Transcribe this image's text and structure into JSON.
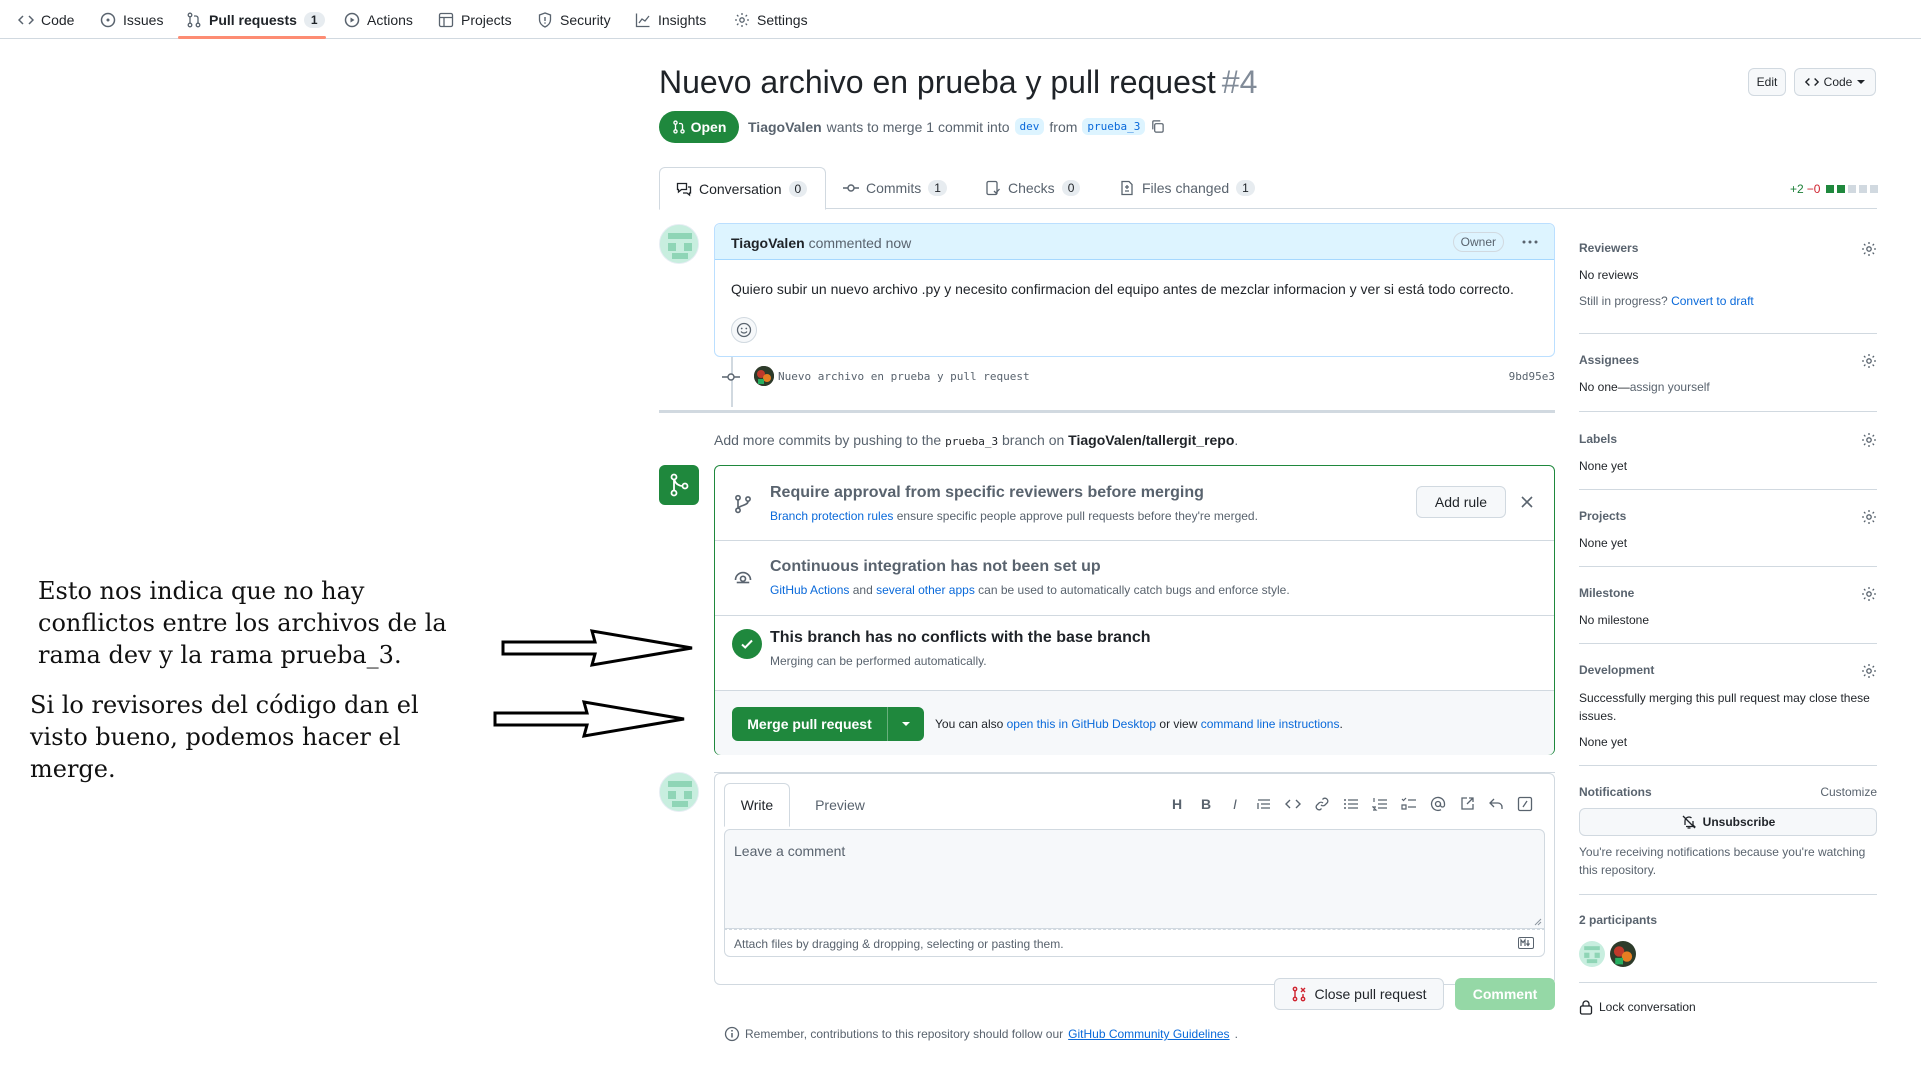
{
  "nav": {
    "code": "Code",
    "issues": "Issues",
    "pulls": "Pull requests",
    "pulls_count": "1",
    "actions": "Actions",
    "projects": "Projects",
    "security": "Security",
    "insights": "Insights",
    "settings": "Settings"
  },
  "pr": {
    "title": "Nuevo archivo en prueba y pull request",
    "number": "#4",
    "state": "Open",
    "author": "TiagoValen",
    "merge_text": "wants to merge 1 commit into",
    "base": "dev",
    "from_text": "from",
    "head": "prueba_3",
    "edit_label": "Edit",
    "code_label": "Code"
  },
  "tabs": [
    {
      "label": "Conversation",
      "count": "0"
    },
    {
      "label": "Commits",
      "count": "1"
    },
    {
      "label": "Checks",
      "count": "0"
    },
    {
      "label": "Files changed",
      "count": "1"
    }
  ],
  "diffstat": {
    "added": "+2",
    "removed": "−0"
  },
  "comment": {
    "author": "TiagoValen",
    "when": "commented now",
    "badge": "Owner",
    "body": "Quiero subir un nuevo archivo .py y necesito confirmacion del equipo antes de mezclar informacion y ver si está todo correcto."
  },
  "commit": {
    "message": "Nuevo archivo en prueba y pull request",
    "sha": "9bd95e3"
  },
  "push_hint": {
    "prefix": "Add more commits by pushing to the",
    "branch": "prueba_3",
    "middle": "branch on",
    "repo": "TiagoValen/tallergit_repo",
    "suffix": "."
  },
  "merge_box": {
    "rule_title": "Require approval from specific reviewers before merging",
    "rule_link": "Branch protection rules",
    "rule_sub": "ensure specific people approve pull requests before they're merged.",
    "add_rule": "Add rule",
    "ci_title": "Continuous integration has not been set up",
    "ci_link1": "GitHub Actions",
    "ci_and": "and",
    "ci_link2": "several other apps",
    "ci_sub": "can be used to automatically catch bugs and enforce style.",
    "noconf_title": "This branch has no conflicts with the base branch",
    "noconf_sub": "Merging can be performed automatically.",
    "merge_button": "Merge pull request",
    "alt_prefix": "You can also",
    "alt_link1": "open this in GitHub Desktop",
    "alt_mid": "or view",
    "alt_link2": "command line instructions",
    "alt_suffix": "."
  },
  "write": {
    "tab_write": "Write",
    "tab_preview": "Preview",
    "placeholder": "Leave a comment",
    "attach": "Attach files by dragging & dropping, selecting or pasting them.",
    "close_button": "Close pull request",
    "comment_button": "Comment",
    "guidelines_prefix": "Remember, contributions to this repository should follow our",
    "guidelines_link": "GitHub Community Guidelines",
    "guidelines_suffix": "."
  },
  "sidebar": {
    "reviewers_title": "Reviewers",
    "reviewers_value": "No reviews",
    "reviewers_progress": "Still in progress?",
    "reviewers_draft": "Convert to draft",
    "assignees_title": "Assignees",
    "assignees_value": "No one—",
    "assignees_link": "assign yourself",
    "labels_title": "Labels",
    "labels_value": "None yet",
    "projects_title": "Projects",
    "projects_value": "None yet",
    "milestone_title": "Milestone",
    "milestone_value": "No milestone",
    "development_title": "Development",
    "development_text": "Successfully merging this pull request may close these issues.",
    "development_value": "None yet",
    "notifications_title": "Notifications",
    "notifications_customize": "Customize",
    "unsubscribe": "Unsubscribe",
    "notifications_reason": "You're receiving notifications because you're watching this repository.",
    "participants": "2 participants",
    "lock": "Lock conversation"
  },
  "annotations": {
    "note1": "Esto nos indica que no hay conflictos entre los archivos de la rama dev y la rama prueba_3.",
    "note2": "Si lo revisores del código dan el visto bueno, podemos hacer el merge."
  },
  "colors": {
    "accent_green": "#1f883d",
    "link_blue": "#0969da",
    "nav_underline": "#fd8c73",
    "danger": "#cf222e"
  }
}
